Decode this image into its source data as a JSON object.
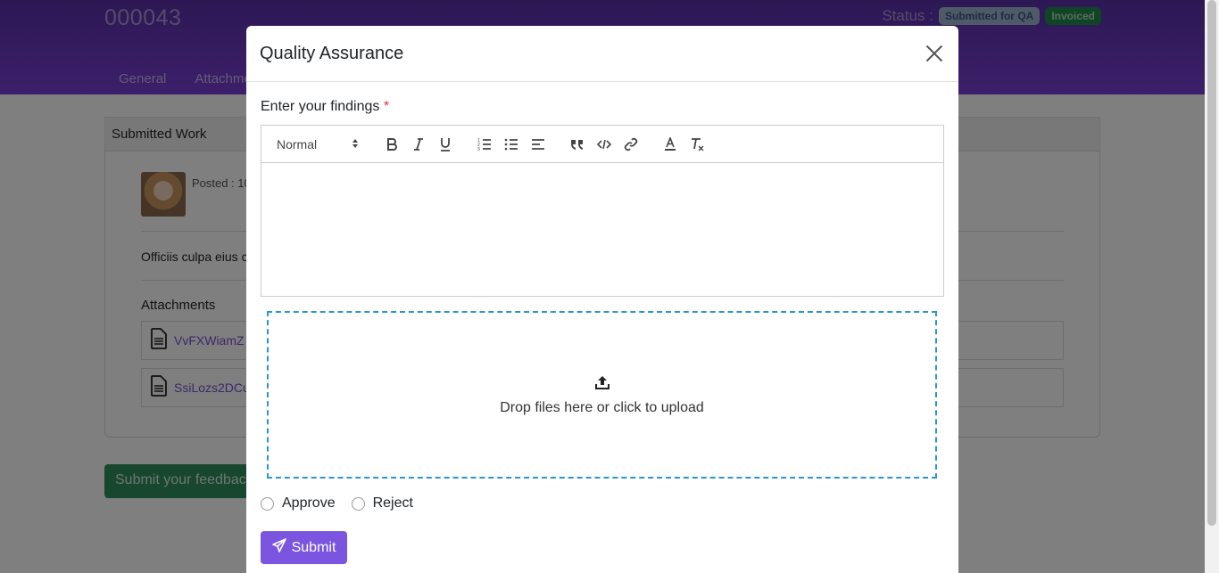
{
  "header": {
    "record_id": "000043",
    "status_label": "Status :",
    "badges": [
      "Submitted for QA",
      "Invoiced"
    ],
    "tabs": [
      "General",
      "Attachme"
    ]
  },
  "card": {
    "title": "Submitted Work",
    "posted": "Posted : 10",
    "description": "Officiis culpa eius c",
    "attachments_title": "Attachments",
    "attachments": [
      "VvFXWiamZ",
      "SsiLozs2DCu"
    ]
  },
  "feedback_button": "Submit your feedbac",
  "modal": {
    "title": "Quality Assurance",
    "findings_label": "Enter your findings",
    "required_mark": "*",
    "editor_format": "Normal",
    "dropzone_text": "Drop files here or click to upload",
    "radio_options": [
      "Approve",
      "Reject"
    ],
    "submit_label": "Submit"
  },
  "colors": {
    "header_purple": "#6a35c2",
    "submit_purple": "#7b55e0",
    "dropzone_border": "#2a95d0",
    "required_red": "#dc3545"
  }
}
